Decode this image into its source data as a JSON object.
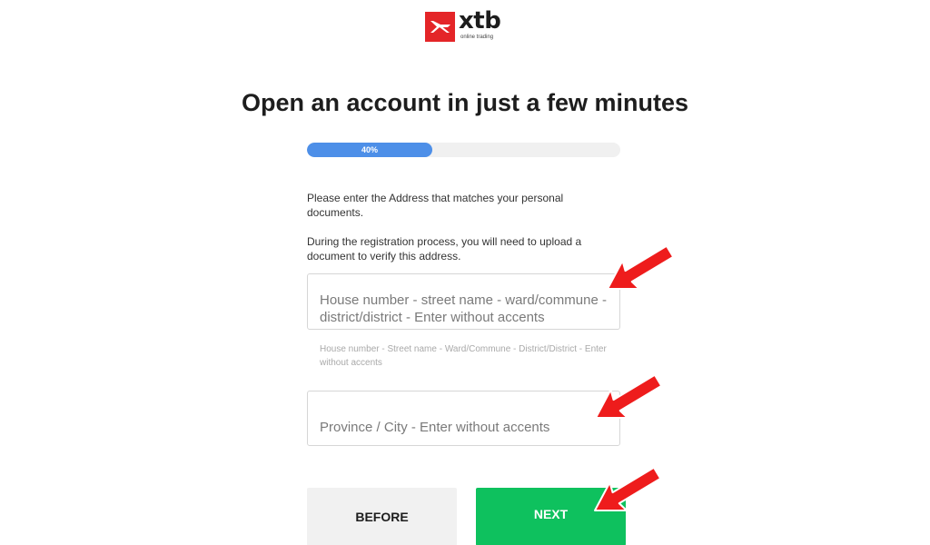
{
  "brand": {
    "name": "xtb",
    "tagline": "online trading",
    "colors": {
      "logo_red": "#e42528",
      "progress_blue": "#4d8fe8",
      "next_green": "#0ec15e",
      "annotation_red": "#ee1c1c"
    }
  },
  "page": {
    "title": "Open an account in just a few minutes"
  },
  "progress": {
    "value": 0.4,
    "label": "40%"
  },
  "instructions": {
    "paragraph1": "Please enter the Address that matches your personal documents.",
    "paragraph2": "During the registration process, you will need to upload a document to verify this address."
  },
  "form": {
    "address": {
      "placeholder": "House number - street name - ward/commune - district/district - Enter without accents",
      "hint": "House number - Street name - Ward/Commune - District/District - Enter without accents"
    },
    "city": {
      "placeholder": "Province / City - Enter without accents"
    }
  },
  "buttons": {
    "before_label": "BEFORE",
    "next_label": "NEXT"
  },
  "annotations": {
    "icon": "red-arrow-icon",
    "count": 3
  }
}
